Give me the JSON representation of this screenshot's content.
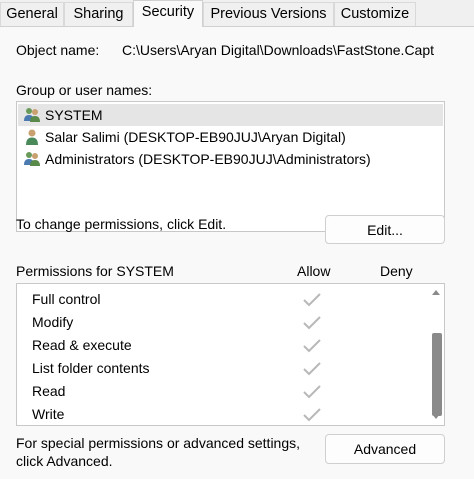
{
  "tabs": [
    {
      "label": "General",
      "active": false
    },
    {
      "label": "Sharing",
      "active": false
    },
    {
      "label": "Security",
      "active": true
    },
    {
      "label": "Previous Versions",
      "active": false
    },
    {
      "label": "Customize",
      "active": false
    }
  ],
  "object": {
    "label": "Object name:",
    "value": "C:\\Users\\Aryan Digital\\Downloads\\FastStone.Capt"
  },
  "groups": {
    "label": "Group or user names:",
    "items": [
      {
        "name": "SYSTEM",
        "icon": "group-users-icon",
        "selected": true
      },
      {
        "name": "Salar Salimi (DESKTOP-EB90JUJ\\Aryan Digital)",
        "icon": "user-icon",
        "selected": false
      },
      {
        "name": "Administrators (DESKTOP-EB90JUJ\\Administrators)",
        "icon": "group-users-icon",
        "selected": false
      }
    ]
  },
  "change": {
    "text": "To change permissions, click Edit.",
    "button": "Edit..."
  },
  "permissions": {
    "header": "Permissions for SYSTEM",
    "allow_label": "Allow",
    "deny_label": "Deny",
    "items": [
      {
        "name": "Full control",
        "allow": true,
        "deny": false
      },
      {
        "name": "Modify",
        "allow": true,
        "deny": false
      },
      {
        "name": "Read & execute",
        "allow": true,
        "deny": false
      },
      {
        "name": "List folder contents",
        "allow": true,
        "deny": false
      },
      {
        "name": "Read",
        "allow": true,
        "deny": false
      },
      {
        "name": "Write",
        "allow": true,
        "deny": false
      }
    ]
  },
  "advanced": {
    "text_line1": "For special permissions or advanced settings,",
    "text_line2": "click Advanced.",
    "button": "Advanced"
  },
  "colors": {
    "check": "#b8b8b8",
    "selected_row": "#e5e5e5",
    "scroll_thumb": "#8a8a8a"
  }
}
